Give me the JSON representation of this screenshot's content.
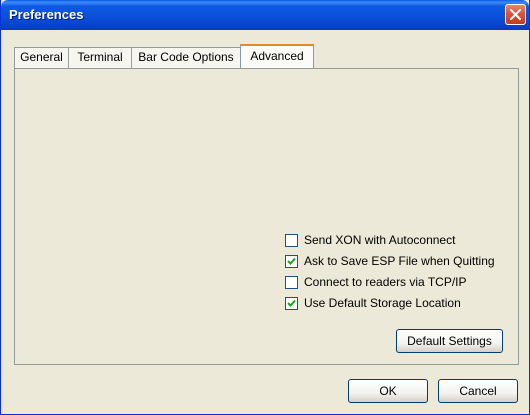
{
  "window": {
    "title": "Preferences"
  },
  "tabs": [
    {
      "label": "General",
      "active": false
    },
    {
      "label": "Terminal",
      "active": false
    },
    {
      "label": "Bar Code Options",
      "active": false
    },
    {
      "label": "Advanced",
      "active": true
    }
  ],
  "options": [
    {
      "label": "Send XON with Autoconnect",
      "checked": false
    },
    {
      "label": "Ask to Save ESP File when Quitting",
      "checked": true
    },
    {
      "label": "Connect to readers via TCP/IP",
      "checked": false
    },
    {
      "label": "Use Default Storage Location",
      "checked": true
    }
  ],
  "buttons": {
    "default_settings": "Default Settings",
    "ok": "OK",
    "cancel": "Cancel"
  },
  "colors": {
    "titlebar": "#0A4FD8",
    "face": "#ECE9D8",
    "tab_active_accent": "#E68B2C",
    "close": "#D9553A"
  }
}
